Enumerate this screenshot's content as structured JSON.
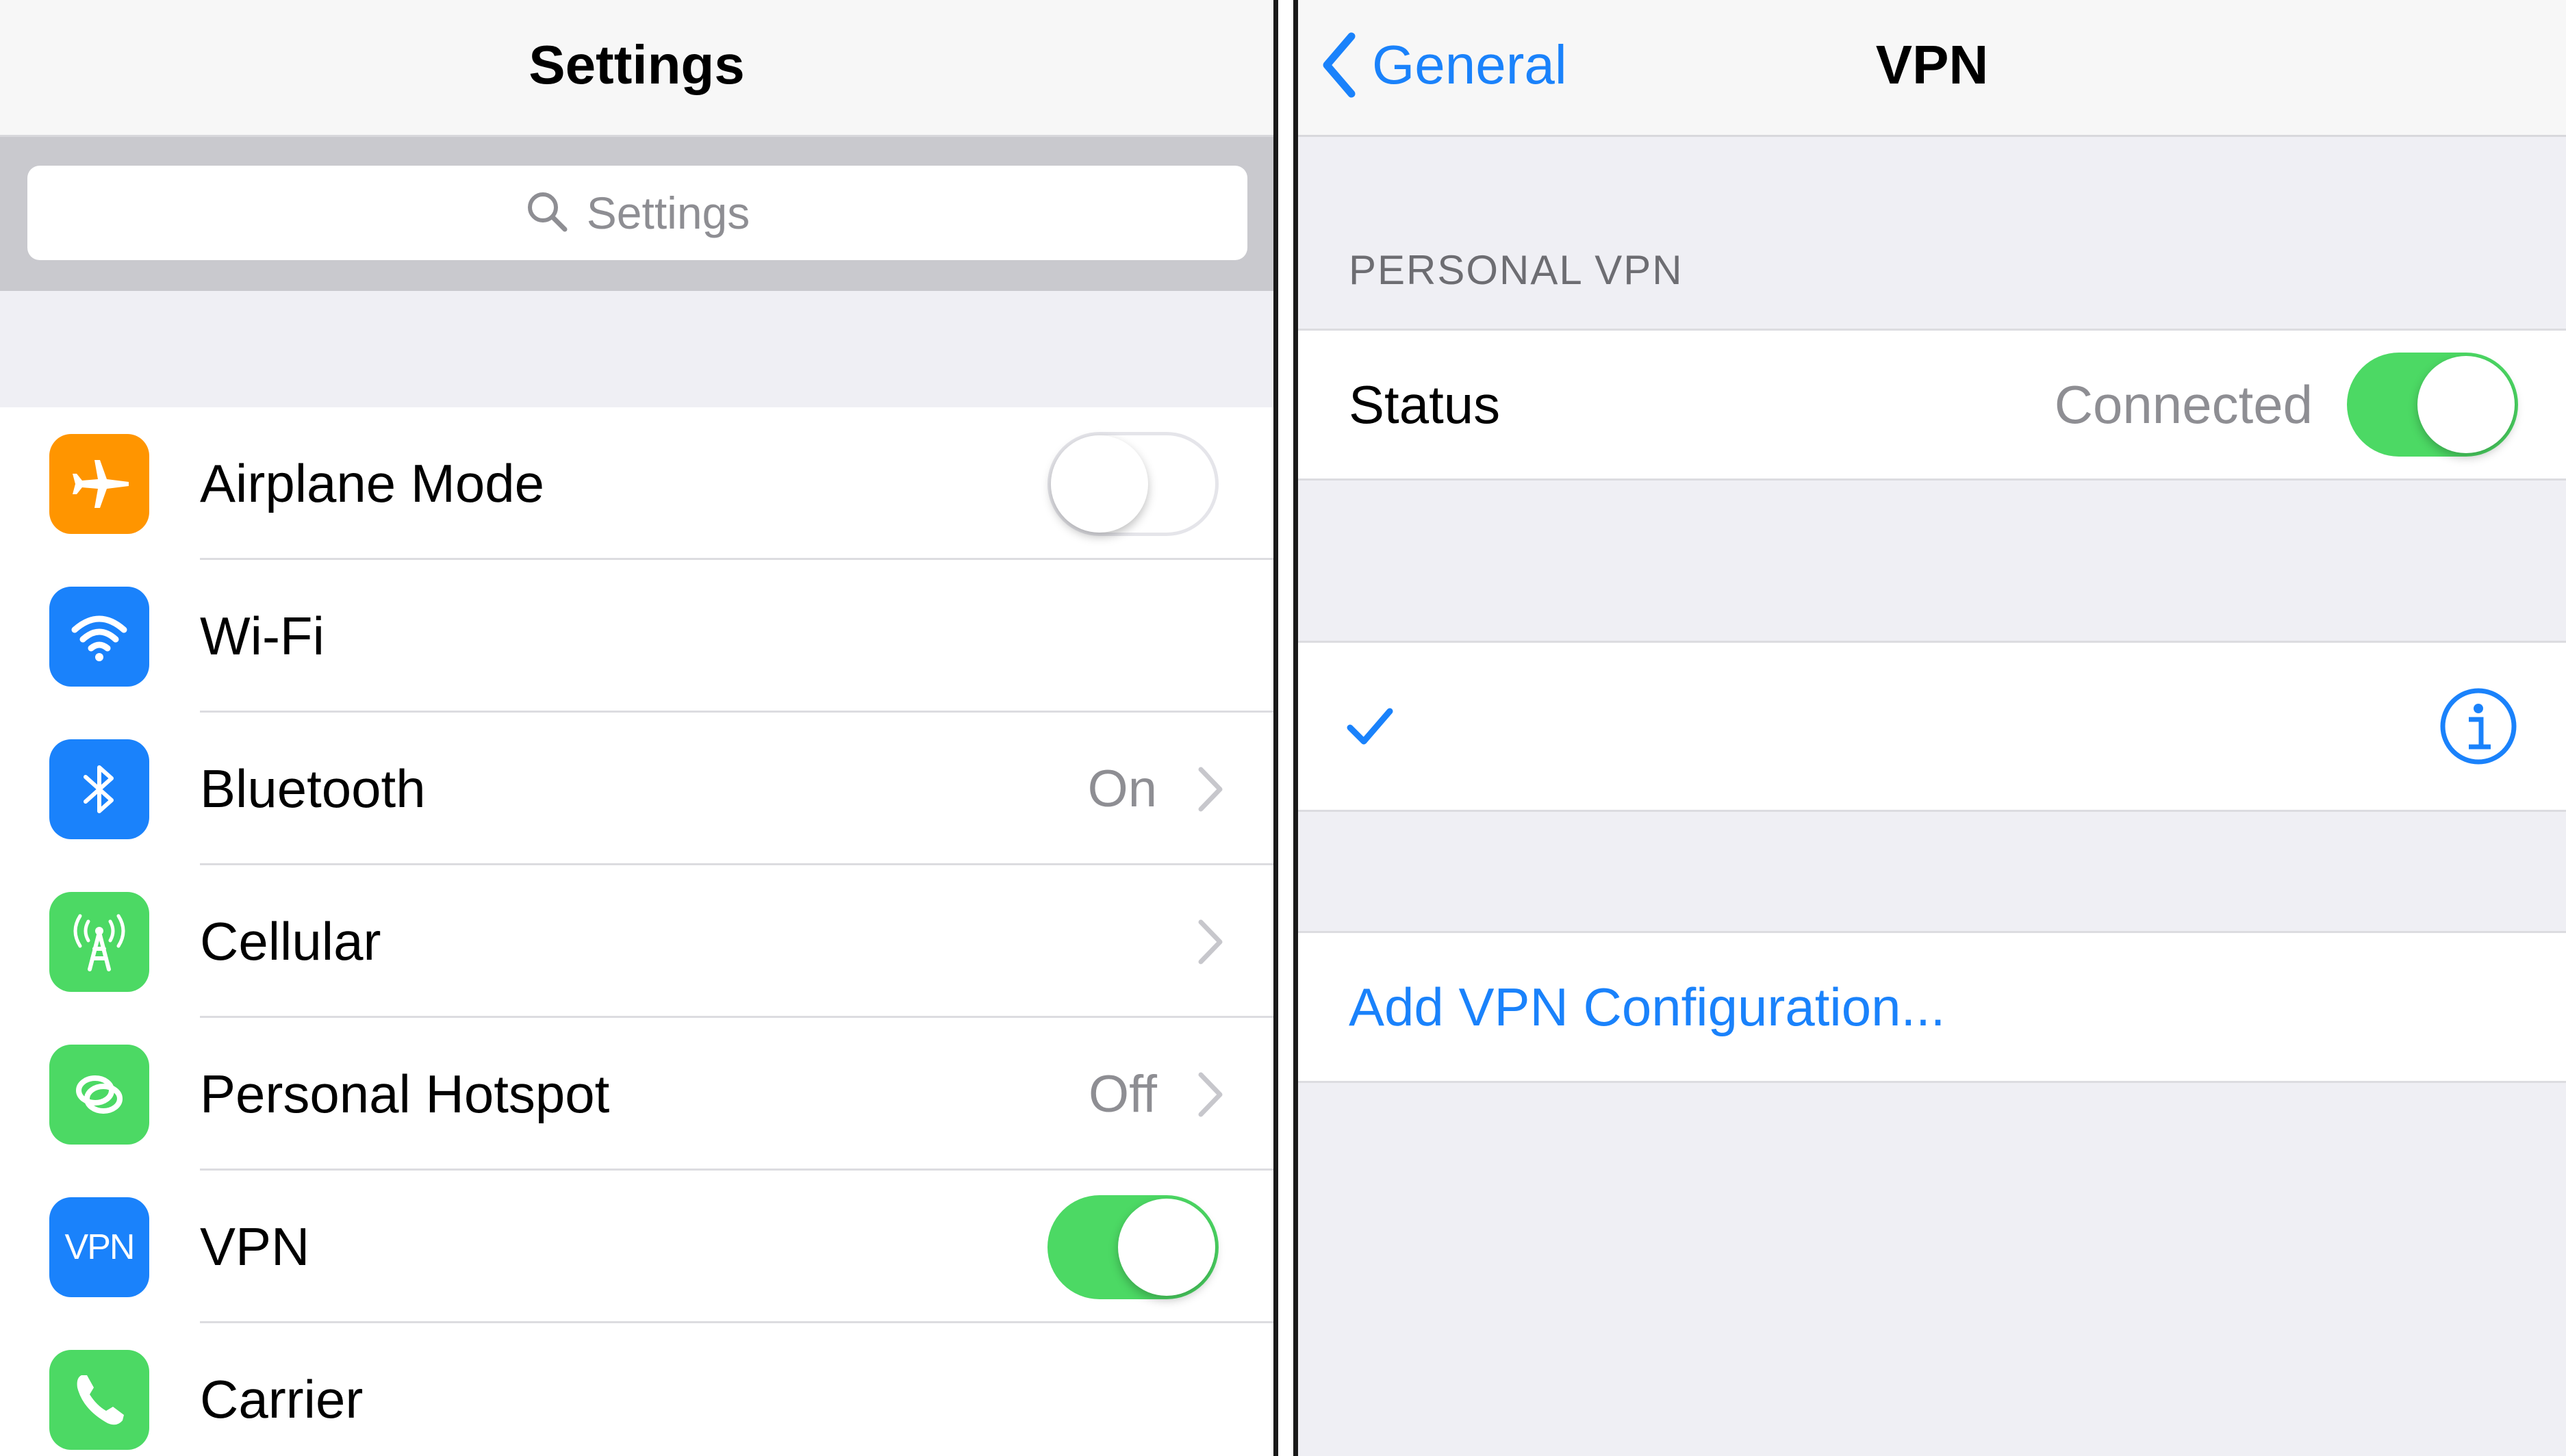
{
  "left": {
    "title": "Settings",
    "search": {
      "placeholder": "Settings",
      "icon": "search-icon"
    },
    "rows": [
      {
        "label": "Airplane Mode",
        "icon": "airplane-icon",
        "icon_color": "#ff9500",
        "toggle": "off"
      },
      {
        "label": "Wi-Fi",
        "icon": "wifi-icon",
        "icon_color": "#1a82fb"
      },
      {
        "label": "Bluetooth",
        "icon": "bluetooth-icon",
        "icon_color": "#1a82fb",
        "value": "On"
      },
      {
        "label": "Cellular",
        "icon": "cellular-antenna-icon",
        "icon_color": "#4cd964"
      },
      {
        "label": "Personal Hotspot",
        "icon": "hotspot-icon",
        "icon_color": "#4cd964",
        "value": "Off"
      },
      {
        "label": "VPN",
        "icon": "vpn-icon",
        "icon_color": "#1a82fb",
        "icon_text": "VPN",
        "toggle": "on"
      },
      {
        "label": "Carrier",
        "icon": "phone-icon",
        "icon_color": "#4cd964"
      }
    ]
  },
  "right": {
    "back_label": "General",
    "title": "VPN",
    "section_header": "PERSONAL VPN",
    "status": {
      "label": "Status",
      "value": "Connected",
      "toggle": "on"
    },
    "add_config_label": "Add VPN Configuration..."
  },
  "colors": {
    "accent": "#1a82fb",
    "toggle_on": "#4cd964",
    "background": "#efeff4",
    "secondary_text": "#8e8e93"
  }
}
